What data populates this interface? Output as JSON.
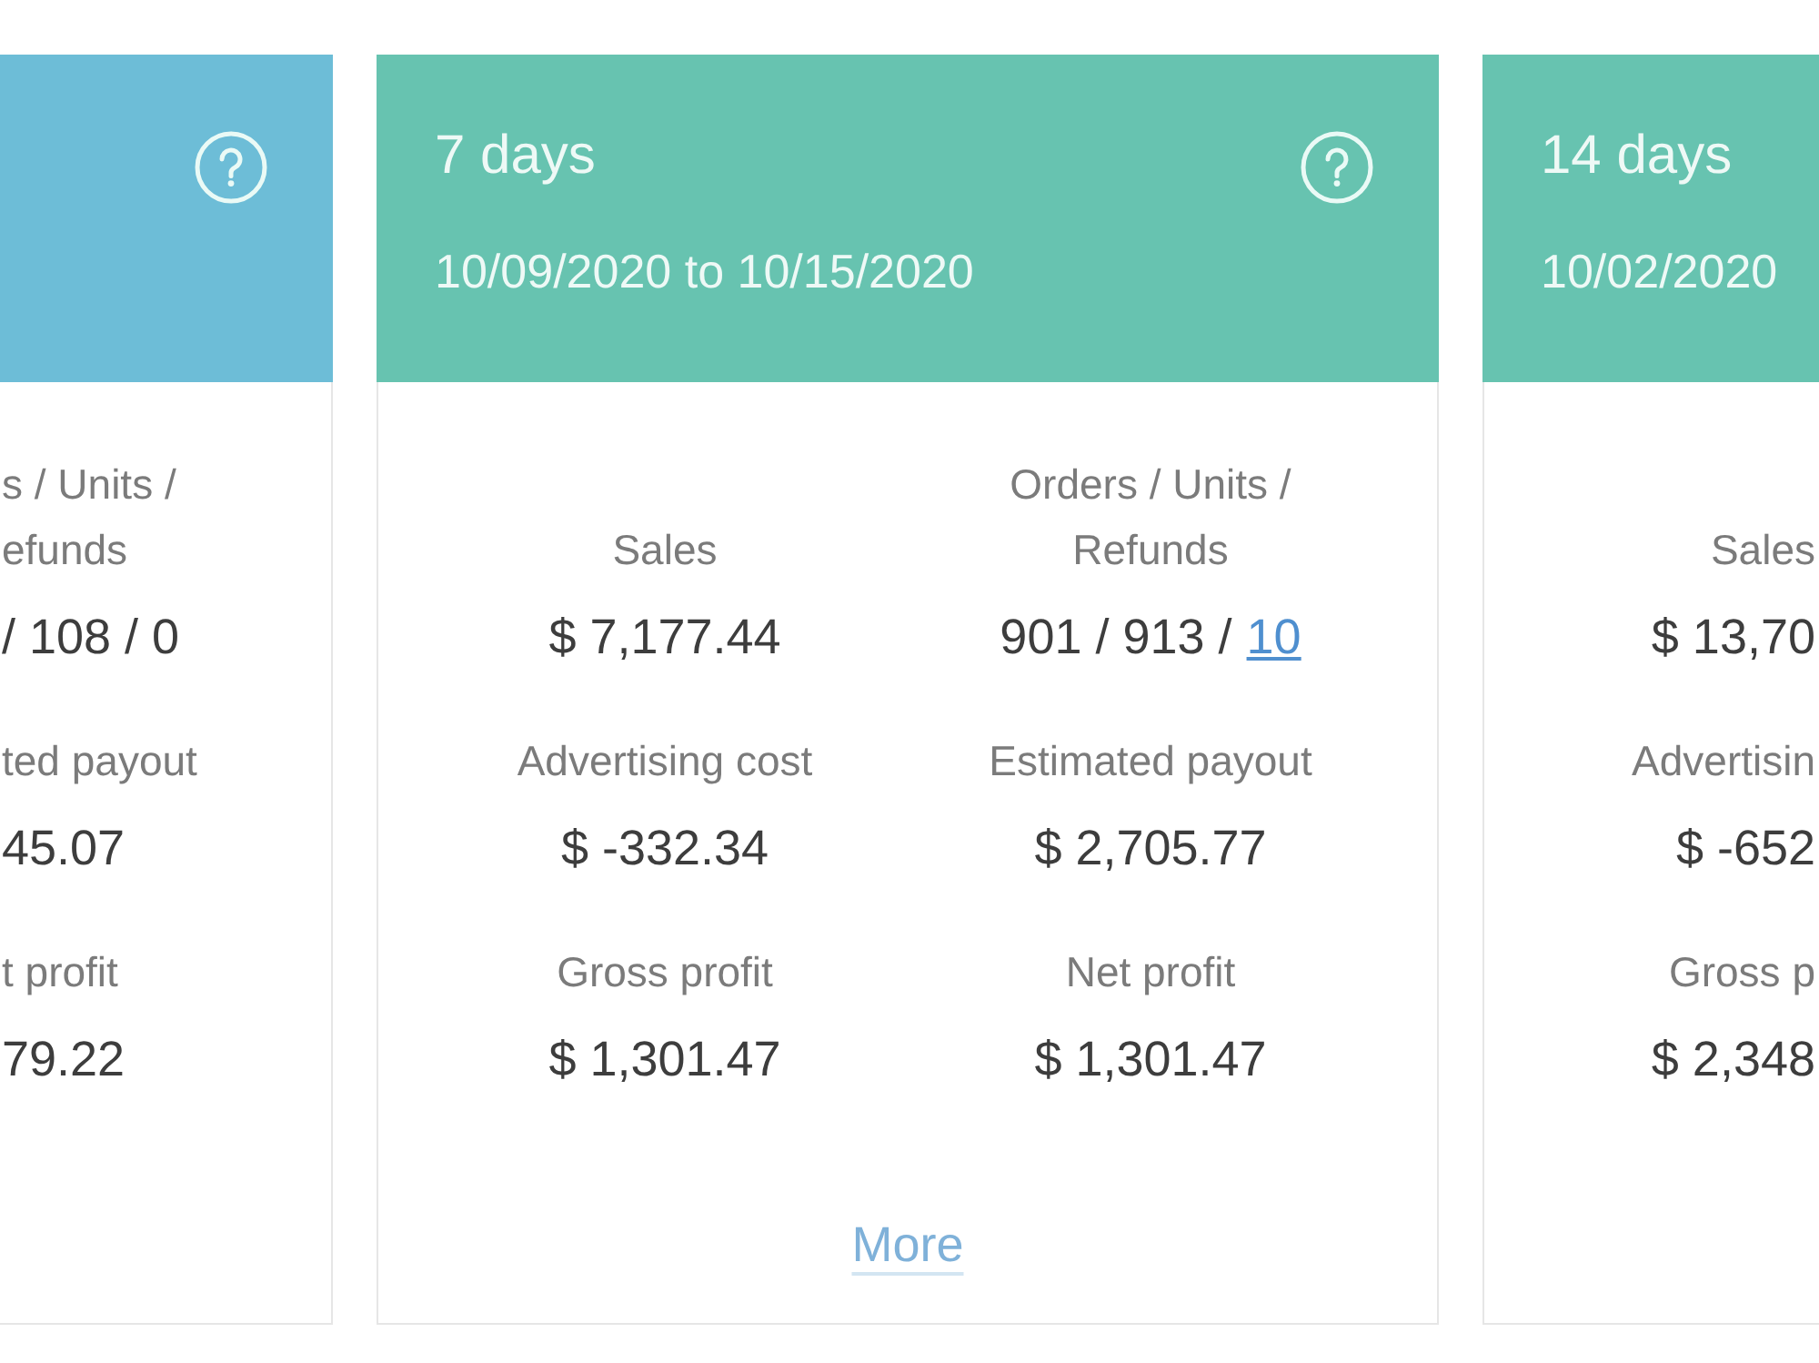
{
  "cards": [
    {
      "kind": "edge_left",
      "color": "#6dbdd7",
      "help": true,
      "stats": [
        {
          "label_lines": [
            "s / Units /",
            "efunds"
          ],
          "value": "/ 108 / 0"
        },
        {
          "label_lines": [
            "ted payout"
          ],
          "value": "45.07"
        },
        {
          "label_lines": [
            "t profit"
          ],
          "value": "79.22"
        }
      ]
    },
    {
      "kind": "full",
      "color": "#67c3b0",
      "title": "7 days",
      "date_range": "10/09/2020 to 10/15/2020",
      "help": true,
      "stats": [
        {
          "label_lines": [
            "Sales"
          ],
          "value": "$ 7,177.44"
        },
        {
          "label_lines": [
            "Advertising cost"
          ],
          "value": "$ -332.34"
        },
        {
          "label_lines": [
            "Gross profit"
          ],
          "value": "$ 1,301.47"
        },
        {
          "label_lines": [
            "Orders / Units /",
            "Refunds"
          ],
          "value": "901 / 913 /",
          "link": "10"
        },
        {
          "label_lines": [
            "Estimated payout"
          ],
          "value": "$ 2,705.77"
        },
        {
          "label_lines": [
            "Net profit"
          ],
          "value": "$ 1,301.47"
        }
      ],
      "more_link": "More"
    },
    {
      "kind": "edge_right",
      "color": "#67c3b0",
      "title": "14 days",
      "date_range": "10/02/2020",
      "stats": [
        {
          "label_lines": [
            "Sales"
          ],
          "value": "$ 13,70"
        },
        {
          "label_lines": [
            "Advertisin"
          ],
          "value": "$ -652"
        },
        {
          "label_lines": [
            "Gross p"
          ],
          "value": "$ 2,348"
        }
      ]
    }
  ]
}
